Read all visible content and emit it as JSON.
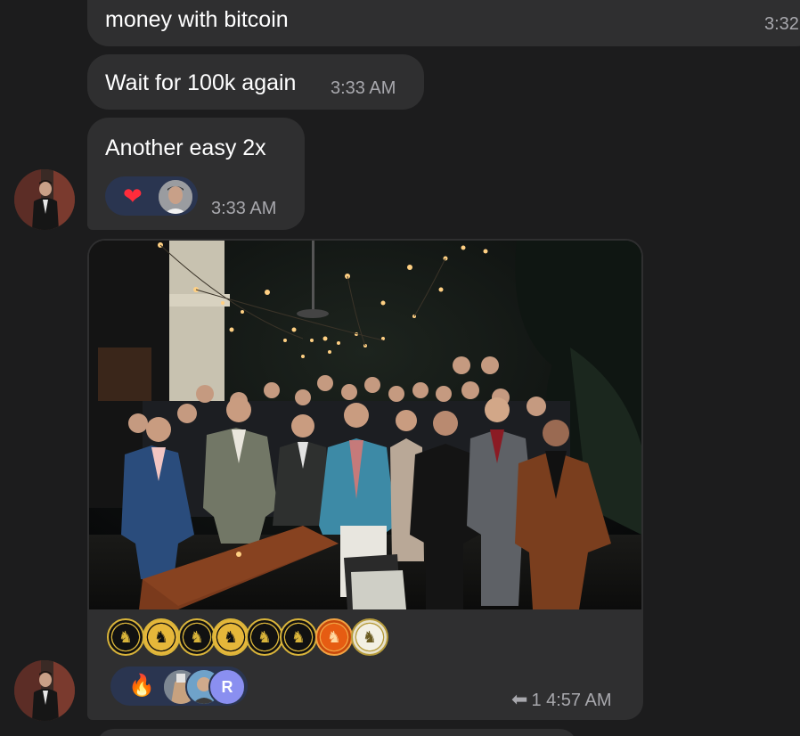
{
  "messages": [
    {
      "text": "money with bitcoin",
      "time": "3:32"
    },
    {
      "text": "Wait for 100k again",
      "time": "3:33 AM"
    },
    {
      "text": "Another easy 2x",
      "time": "3:33 AM",
      "reaction": {
        "emoji": "❤"
      }
    },
    {
      "type": "photo",
      "time": "4:57 AM",
      "reply_count": "1",
      "reactions": {
        "emoji": "🔥",
        "initial": "R"
      }
    }
  ],
  "icons": {
    "heart": "heart-icon",
    "fire": "fire-icon",
    "reply": "reply-arrow-icon"
  },
  "colors": {
    "background": "#1c1c1d",
    "bubble": "#2f2f30",
    "reaction_pill": "#2a3550",
    "heart": "#ff2c3b",
    "timestamp": "#a8a8ad"
  }
}
